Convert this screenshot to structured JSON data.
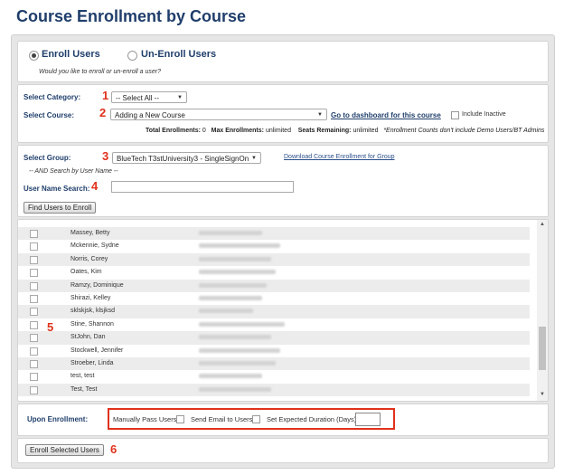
{
  "page_title": "Course Enrollment by Course",
  "mode": {
    "enroll_label": "Enroll Users",
    "unenroll_label": "Un-Enroll Users",
    "question": "Would you like to enroll or un-enroll a user?"
  },
  "filters": {
    "category_label": "Select Category:",
    "category_value": "-- Select All --",
    "course_label": "Select Course:",
    "course_value": "Adding a New Course",
    "dashboard_link": "Go to dashboard for this course",
    "include_inactive": "Include Inactive",
    "total_enrollments_label": "Total Enrollments:",
    "total_enrollments_value": "0",
    "max_enrollments_label": "Max Enrollments:",
    "max_enrollments_value": "unlimited",
    "seats_remaining_label": "Seats Remaining:",
    "seats_remaining_value": "unlimited",
    "note": "*Enrollment Counts don't include Demo Users/BT Admins"
  },
  "group": {
    "label": "Select Group:",
    "value": "BlueTech T3stUniversity3 - SingleSignOn",
    "download_link": "Download Course Enrollment for Group",
    "and_search": "-- AND Search by User Name --",
    "username_label": "User Name Search:",
    "username_value": "",
    "find_button": "Find Users to Enroll"
  },
  "markers": {
    "m1": "1",
    "m2": "2",
    "m3": "3",
    "m4": "4",
    "m5": "5",
    "m6": "6"
  },
  "users": [
    {
      "name": "Massey, Betty"
    },
    {
      "name": "Mckennie, Sydne"
    },
    {
      "name": "Norris, Corey"
    },
    {
      "name": "Oates, Kim"
    },
    {
      "name": "Ramzy, Dominique"
    },
    {
      "name": "Shirazi, Kelley"
    },
    {
      "name": "sklskjsk, klsjksd"
    },
    {
      "name": "Stine, Shannon"
    },
    {
      "name": "StJohn, Dan"
    },
    {
      "name": "Stockwell, Jennifer"
    },
    {
      "name": "Stroeber, Linda"
    },
    {
      "name": "test, test"
    },
    {
      "name": "Test, Test"
    }
  ],
  "upon_enrollment": {
    "label": "Upon Enrollment:",
    "manually_pass": "Manually Pass Users",
    "send_email": "Send Email to Users",
    "expected_duration": "Set Expected Duration (Days)",
    "duration_value": ""
  },
  "submit_button": "Enroll Selected Users",
  "colors": {
    "title": "#1f3e6b",
    "marker": "#e0311c",
    "highlight_box": "#e0311c"
  }
}
